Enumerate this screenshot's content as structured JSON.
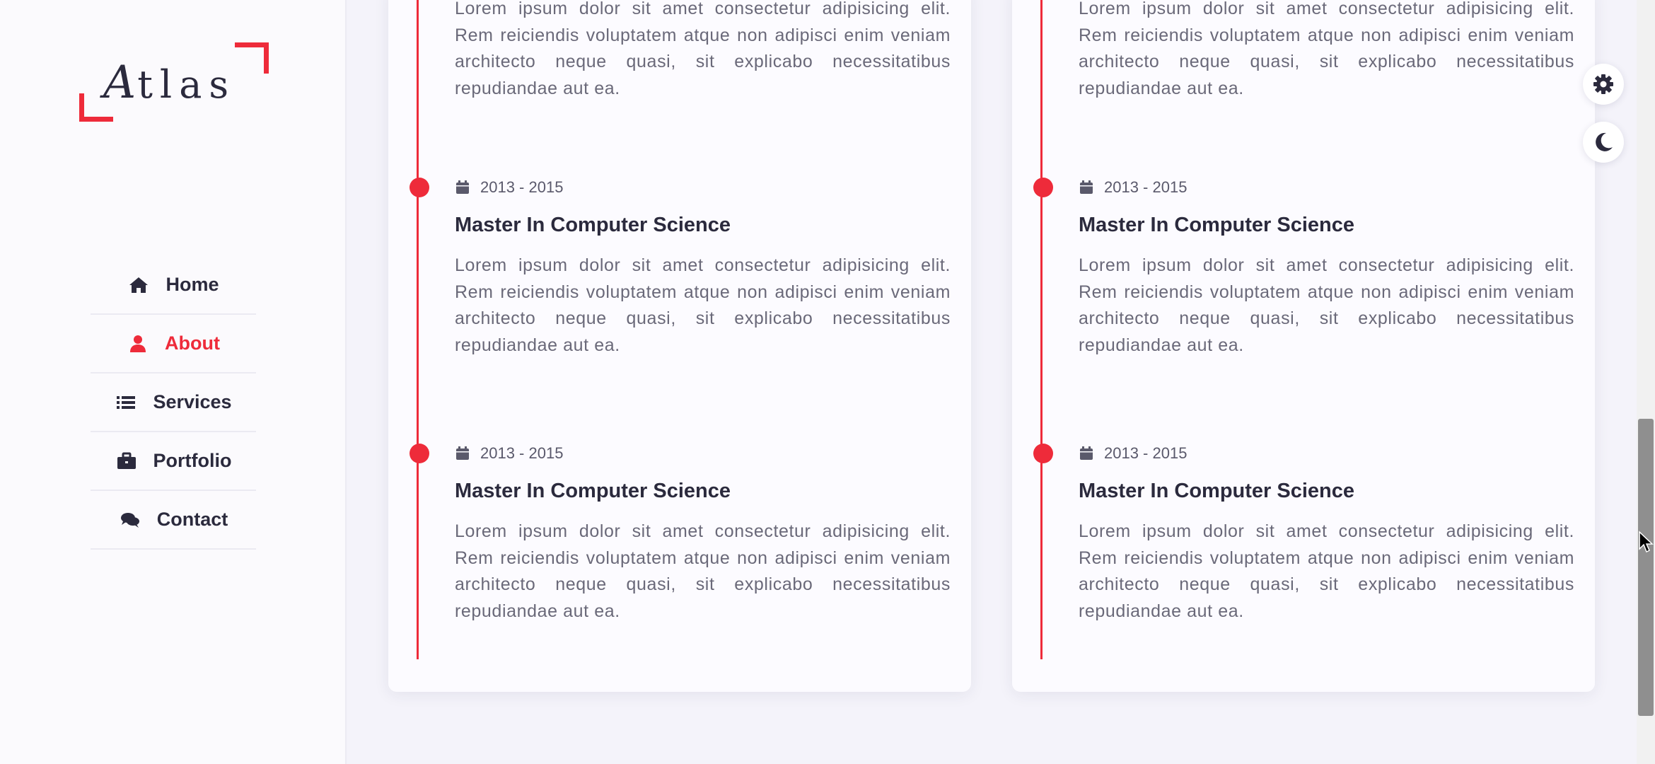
{
  "brand": {
    "logo_first": "A",
    "logo_rest": "tlas",
    "accent": "#ee2b3a"
  },
  "nav": {
    "items": [
      {
        "label": "Home",
        "icon": "home-icon"
      },
      {
        "label": "About",
        "icon": "user-icon",
        "active": true
      },
      {
        "label": "Services",
        "icon": "list-icon"
      },
      {
        "label": "Portfolio",
        "icon": "briefcase-icon"
      },
      {
        "label": "Contact",
        "icon": "comments-icon"
      }
    ]
  },
  "timeline": {
    "left": [
      {
        "text": "Lorem ipsum dolor sit amet consectetur adipisicing elit. Rem reiciendis voluptatem atque non adipisci enim veniam architecto neque quasi, sit explicabo necessitatibus repudiandae aut ea."
      },
      {
        "date": "2013 - 2015",
        "title": "Master In Computer Science",
        "text": "Lorem ipsum dolor sit amet consectetur adipisicing elit. Rem reiciendis voluptatem atque non adipisci enim veniam architecto neque quasi, sit explicabo necessitatibus repudiandae aut ea."
      },
      {
        "date": "2013 - 2015",
        "title": "Master In Computer Science",
        "text": "Lorem ipsum dolor sit amet consectetur adipisicing elit. Rem reiciendis voluptatem atque non adipisci enim veniam architecto neque quasi, sit explicabo necessitatibus repudiandae aut ea."
      }
    ],
    "right": [
      {
        "text": "Lorem ipsum dolor sit amet consectetur adipisicing elit. Rem reiciendis voluptatem atque non adipisci enim veniam architecto neque quasi, sit explicabo necessitatibus repudiandae aut ea."
      },
      {
        "date": "2013 - 2015",
        "title": "Master In Computer Science",
        "text": "Lorem ipsum dolor sit amet consectetur adipisicing elit. Rem reiciendis voluptatem atque non adipisci enim veniam architecto neque quasi, sit explicabo necessitatibus repudiandae aut ea."
      },
      {
        "date": "2013 - 2015",
        "title": "Master In Computer Science",
        "text": "Lorem ipsum dolor sit amet consectetur adipisicing elit. Rem reiciendis voluptatem atque non adipisci enim veniam architecto neque quasi, sit explicabo necessitatibus repudiandae aut ea."
      }
    ]
  },
  "controls": {
    "settings_icon": "gear-icon",
    "theme_icon": "moon-icon"
  }
}
